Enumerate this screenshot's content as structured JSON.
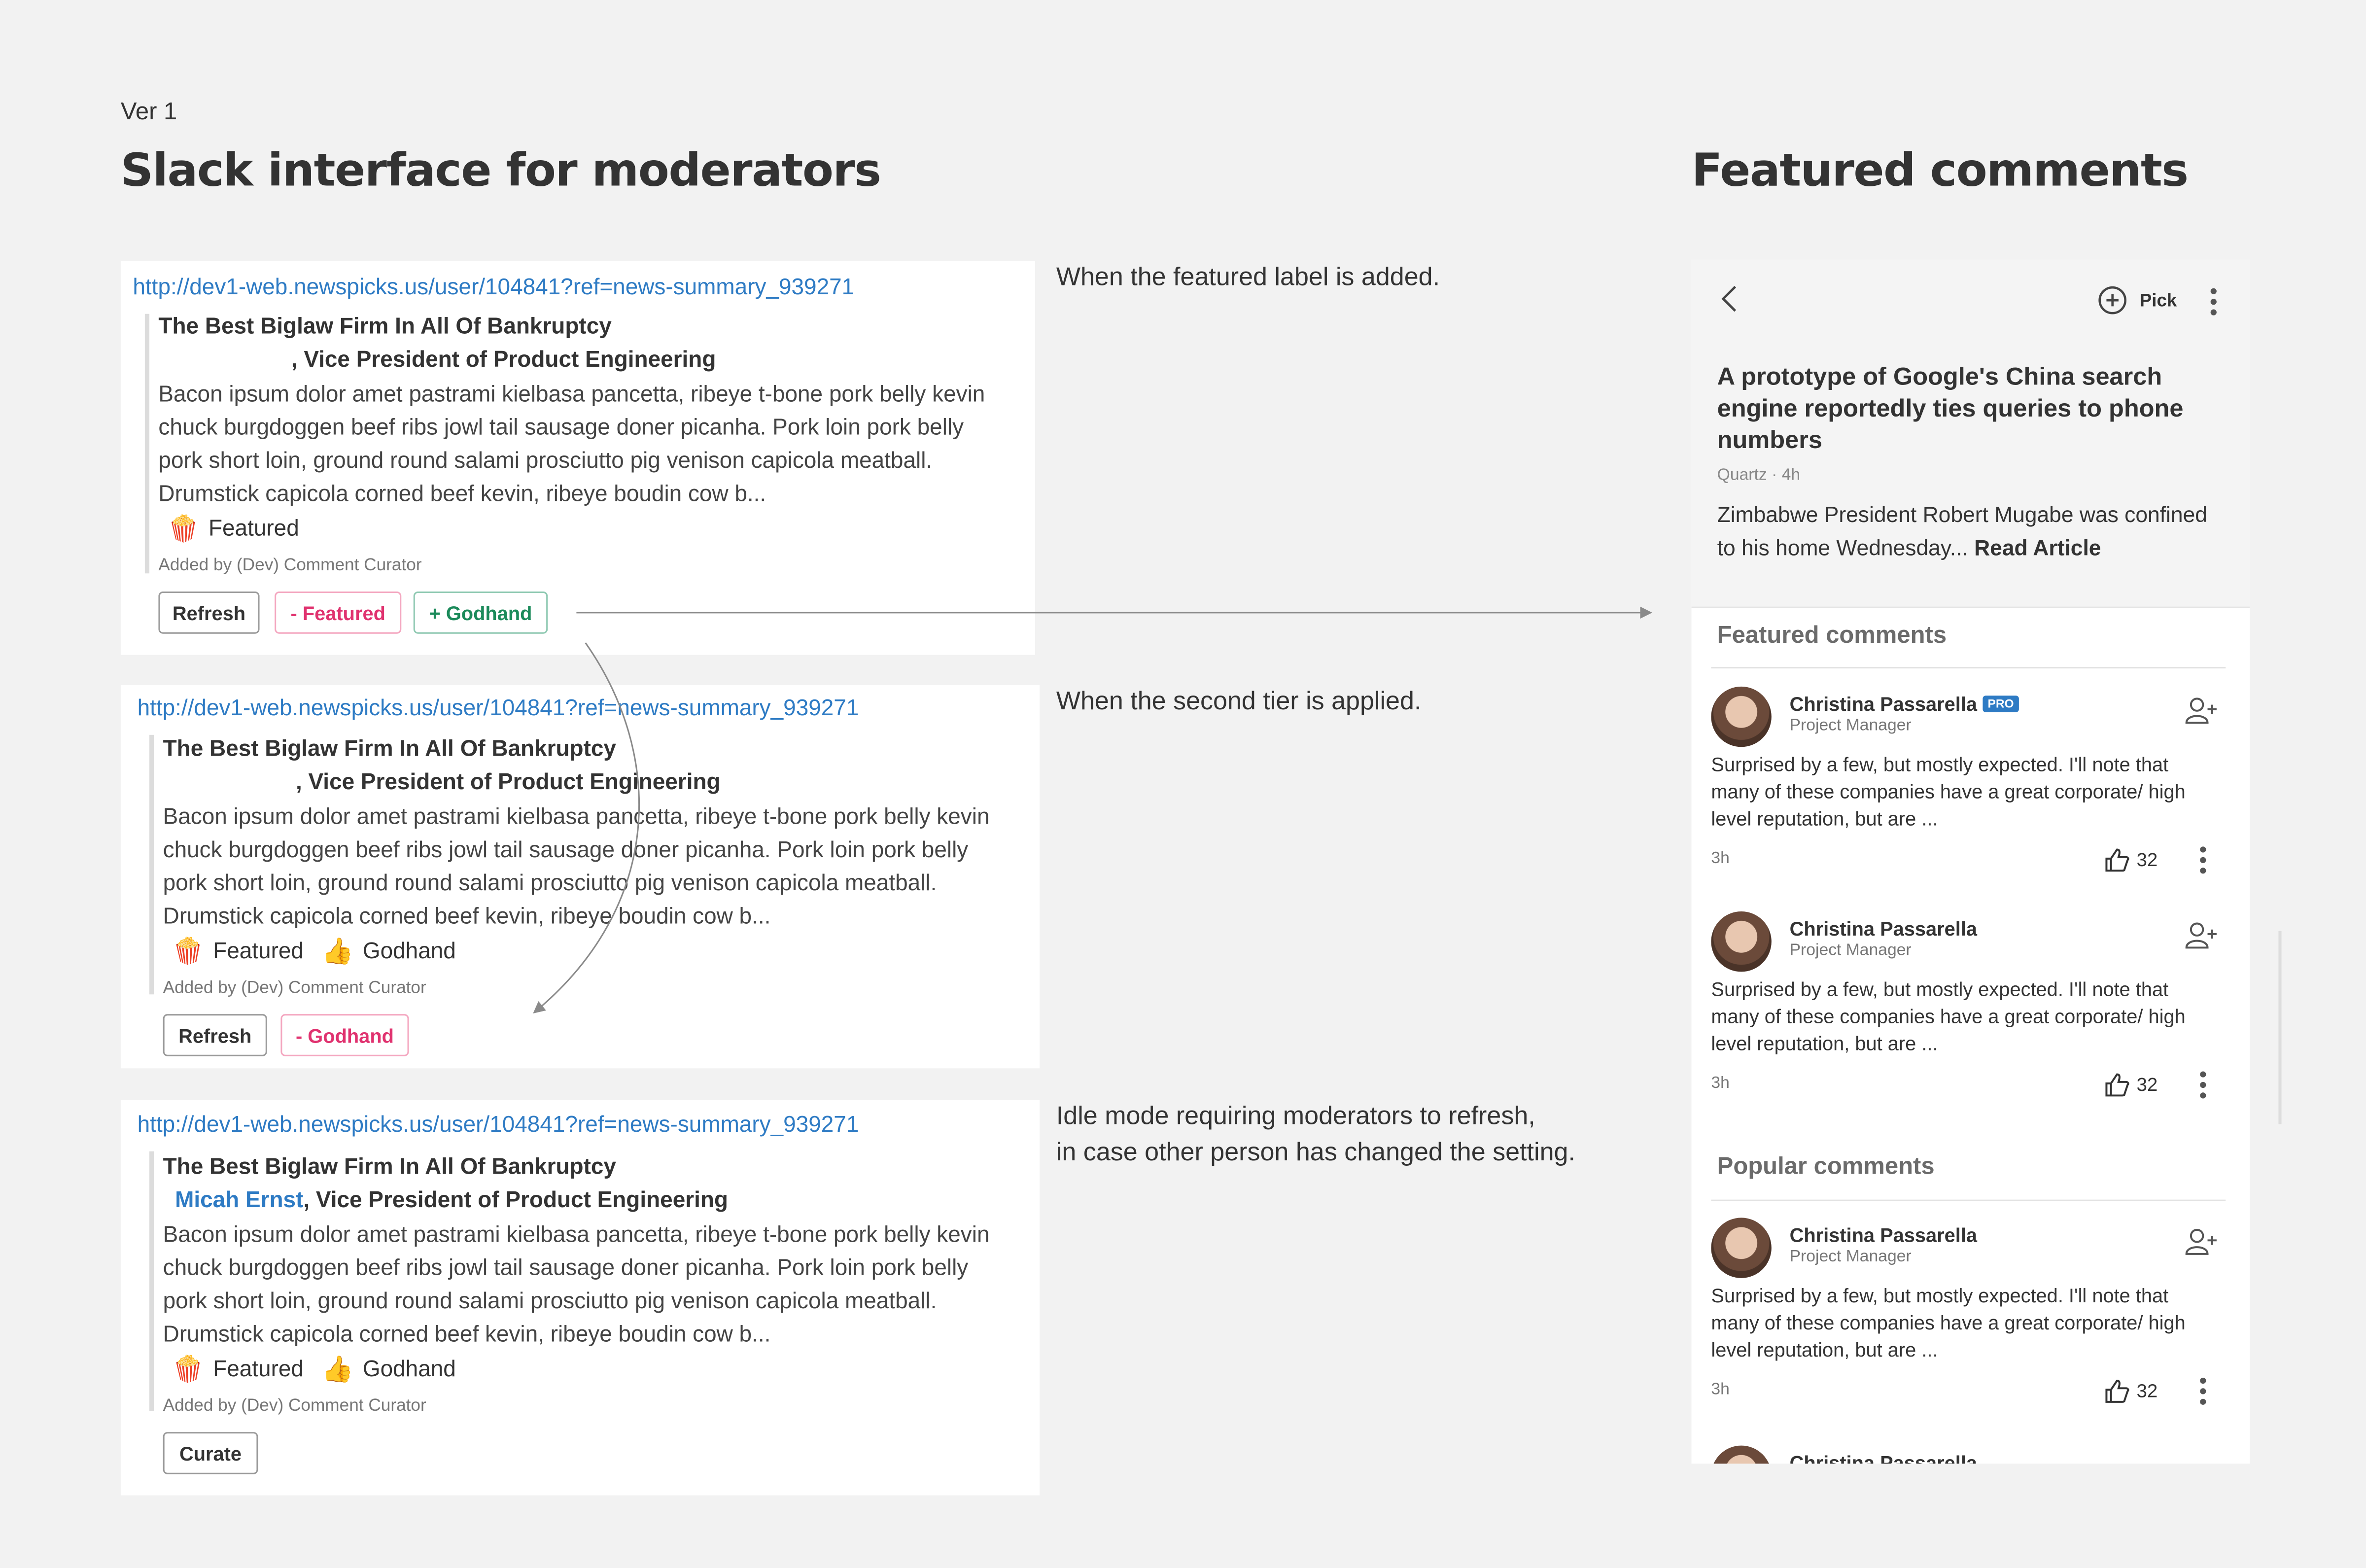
{
  "version_label": "Ver 1",
  "left_heading": "Slack interface for moderators",
  "right_heading": "Featured comments",
  "cards": [
    {
      "link": "http://dev1-web.newspicks.us/user/104841?ref=news-summary_939271",
      "title": "The Best Biglaw Firm In All Of Bankruptcy",
      "author": "",
      "byline_role": ", Vice President of Product Engineering",
      "body_lines": [
        "Bacon ipsum dolor amet pastrami kielbasa pancetta, ribeye t-bone pork belly kevin",
        "chuck burgdoggen beef ribs jowl tail sausage doner picanha. Pork loin pork belly",
        "pork short loin, ground round salami prosciutto pig venison capicola meatball.",
        "Drumstick capicola corned beef kevin, ribeye boudin cow b..."
      ],
      "tags": [
        {
          "emoji": "🍿",
          "label": "Featured"
        }
      ],
      "added_by": "Added by (Dev) Comment Curator",
      "buttons": [
        {
          "label": "Refresh",
          "style": "neutral"
        },
        {
          "label": "- Featured",
          "style": "danger"
        },
        {
          "label": "+ Godhand",
          "style": "primary"
        }
      ]
    },
    {
      "link": "http://dev1-web.newspicks.us/user/104841?ref=news-summary_939271",
      "title": "The Best Biglaw Firm In All Of Bankruptcy",
      "author": "",
      "byline_role": ", Vice President of Product Engineering",
      "body_lines": [
        "Bacon ipsum dolor amet pastrami kielbasa pancetta, ribeye t-bone pork belly kevin",
        "chuck burgdoggen beef ribs jowl tail sausage doner picanha. Pork loin pork belly",
        "pork short loin, ground round salami prosciutto pig venison capicola meatball.",
        "Drumstick capicola corned beef kevin, ribeye boudin cow b..."
      ],
      "tags": [
        {
          "emoji": "🍿",
          "label": "Featured"
        },
        {
          "emoji": "👍",
          "label": "Godhand"
        }
      ],
      "added_by": "Added by (Dev) Comment Curator",
      "buttons": [
        {
          "label": "Refresh",
          "style": "neutral"
        },
        {
          "label": "- Godhand",
          "style": "danger"
        }
      ]
    },
    {
      "link": "http://dev1-web.newspicks.us/user/104841?ref=news-summary_939271",
      "title": "The Best Biglaw Firm In All Of Bankruptcy",
      "author": "Micah Ernst",
      "byline_role": ", Vice President of Product Engineering",
      "body_lines": [
        "Bacon ipsum dolor amet pastrami kielbasa pancetta, ribeye t-bone pork belly kevin",
        "chuck burgdoggen beef ribs jowl tail sausage doner picanha. Pork loin pork belly",
        "pork short loin, ground round salami prosciutto pig venison capicola meatball.",
        "Drumstick capicola corned beef kevin, ribeye boudin cow b..."
      ],
      "tags": [
        {
          "emoji": "🍿",
          "label": "Featured"
        },
        {
          "emoji": "👍",
          "label": "Godhand"
        }
      ],
      "added_by": "Added by (Dev) Comment Curator",
      "buttons": [
        {
          "label": "Curate",
          "style": "neutral"
        }
      ]
    }
  ],
  "notes": [
    "When the featured label is added.",
    "When the second tier is applied.",
    "Idle mode requiring moderators to refresh,\nin case other person has changed the setting."
  ],
  "phone": {
    "pick_label": "Pick",
    "article_title": "A prototype of Google's China search engine reportedly ties queries to phone numbers",
    "source": "Quartz",
    "age": "4h",
    "summary": "Zimbabwe President Robert Mugabe was confined to his home Wednesday...",
    "read_label": "Read Article",
    "featured_header": "Featured comments",
    "popular_header": "Popular comments",
    "comments": [
      {
        "name": "Christina Passarella",
        "pro": "PRO",
        "role": "Project Manager",
        "text": "Surprised by a few, but mostly expected. I'll note that many of these companies have a great corporate/ high level reputation, but are ...",
        "time": "3h",
        "likes": "32"
      },
      {
        "name": "Christina Passarella",
        "pro": "",
        "role": "Project Manager",
        "text": "Surprised by a few, but mostly expected. I'll note that many of these companies have a great corporate/ high level reputation, but are ...",
        "time": "3h",
        "likes": "32"
      },
      {
        "name": "Christina Passarella",
        "pro": "",
        "role": "Project Manager",
        "text": "Surprised by a few, but mostly expected. I'll note that many of these companies have a great corporate/ high level reputation, but are ...",
        "time": "3h",
        "likes": "32"
      },
      {
        "name": "Christina Passarella",
        "pro": "",
        "role": "",
        "text": "",
        "time": "",
        "likes": ""
      }
    ]
  },
  "colors": {
    "link": "#2e7bc4",
    "danger": "#e0326f",
    "primary": "#1b8a5a",
    "pro_badge": "#2e7bc4",
    "background": "#f2f2f2"
  }
}
